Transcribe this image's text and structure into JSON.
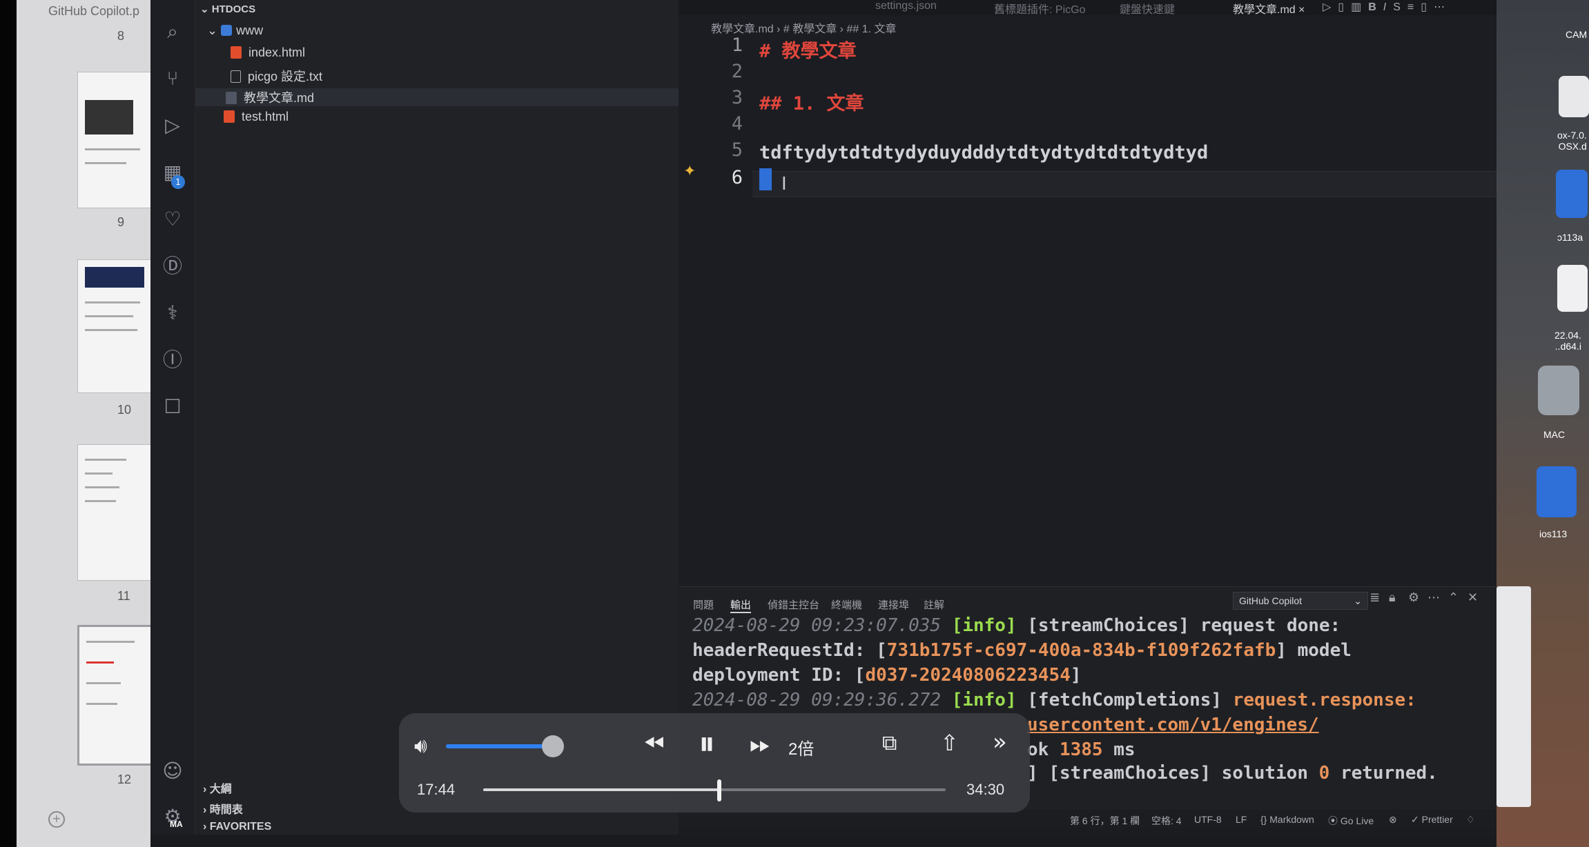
{
  "pdf": {
    "title": "GitHub Copilot.p",
    "pages": [
      "8",
      "9",
      "10",
      "11",
      "12"
    ]
  },
  "activity": {
    "icons": [
      "search-icon",
      "source-control-icon",
      "run-debug-icon",
      "extensions-icon",
      "heart-icon",
      "timeline-icon",
      "python-icon",
      "list-icon",
      "chat-icon",
      "account-icon",
      "settings-icon"
    ],
    "extensions_badge": "1",
    "settings_badge": "MA"
  },
  "explorer": {
    "root": "HTDOCS",
    "folder": "www",
    "files": [
      "index.html",
      "picgo 設定.txt",
      "教學文章.md",
      "test.html"
    ],
    "sections": [
      "大綱",
      "時間表",
      "FAVORITES"
    ]
  },
  "tabs": [
    "settings.json",
    "舊標題插件: PicGo",
    "鍵盤快速鍵",
    "教學文章.md"
  ],
  "breadcrumb": "教學文章.md › # 教學文章 › ## 1. 文章",
  "editor": {
    "lines": [
      {
        "n": "1",
        "text": "# 教學文章"
      },
      {
        "n": "2",
        "text": ""
      },
      {
        "n": "3",
        "text": "## 1. 文章"
      },
      {
        "n": "4",
        "text": ""
      },
      {
        "n": "5",
        "text": "tdftydytdtdtydyduydddytdtydtydtdtdtydtyd"
      },
      {
        "n": "6",
        "text": ""
      }
    ],
    "heading_color": "#e0463c",
    "text_color": "#cfd1d6"
  },
  "panel": {
    "tabs": [
      "問題",
      "輸出",
      "偵錯主控台",
      "終端機",
      "連接埠",
      "註解"
    ],
    "active_tab": "輸出",
    "channel": "GitHub Copilot",
    "log": {
      "l1_ts": "2024-08-29 09:23:07.035",
      "l1_level": "[info]",
      "l1_msg": " [streamChoices] request done:",
      "l2_pre": "headerRequestId: [",
      "l2_id": "731b175f-c697-400a-834b-f109f262fafb",
      "l2_post": "] model",
      "l3_pre": "deployment ID: [",
      "l3_id": "d037-20240806223454",
      "l3_post": "]",
      "l4_ts": "2024-08-29 09:29:36.272",
      "l4_level": "[info]",
      "l4_msg": " [fetchCompletions] ",
      "l4_tail": "request.response:",
      "l5_url": "usercontent.com/v1/engines/",
      "l6_pre": "ok ",
      "l6_num": "1385",
      "l6_post": " ms",
      "l7_pre": "] [streamChoices] solution ",
      "l7_num": "0",
      "l7_post": " returned."
    }
  },
  "status": {
    "position": "第 6 行，第 1 欄",
    "spaces": "空格: 4",
    "encoding": "UTF-8",
    "eol": "LF",
    "language": "Markdown",
    "golive": "Go Live",
    "prettier": "Prettier"
  },
  "desktop": {
    "items": [
      "CAM",
      "ox-7.0.\nOSX.d",
      "ɔ113a",
      "22.04.\n..d64.i",
      "MAC",
      "ios113"
    ]
  },
  "video": {
    "elapsed": "17:44",
    "remaining": "34:30",
    "speed": "2倍",
    "progress": 0.51,
    "volume": 0.97
  }
}
